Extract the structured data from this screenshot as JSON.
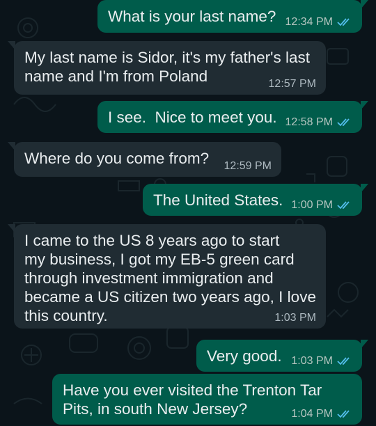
{
  "colors": {
    "background": "#0b141a",
    "outgoing_bubble": "#005c4b",
    "incoming_bubble": "#202c33",
    "read_ticks": "#53bdeb"
  },
  "messages": [
    {
      "direction": "out",
      "text": "What is your last name?",
      "time": "12:34 PM",
      "status": "read"
    },
    {
      "direction": "in",
      "text": "My last name is Sidor, it's my father's last\nname and I'm from Poland",
      "time": "12:57 PM"
    },
    {
      "direction": "out",
      "text": "I see.  Nice to meet you.",
      "time": "12:58 PM",
      "status": "read"
    },
    {
      "direction": "in",
      "text": "Where do you come from?",
      "time": "12:59 PM"
    },
    {
      "direction": "out",
      "text": "The United States.",
      "time": "1:00 PM",
      "status": "read"
    },
    {
      "direction": "in",
      "text": "I came to the US 8 years ago to start\nmy business, I got my EB-5 green card\nthrough investment immigration and\nbecame a US citizen two years ago, I love\nthis country.",
      "time": "1:03 PM"
    },
    {
      "direction": "out",
      "text": "Very good.",
      "time": "1:03 PM",
      "status": "read"
    },
    {
      "direction": "out",
      "text": "Have you ever visited the Trenton Tar\nPits, in south New Jersey?",
      "time": "1:04 PM",
      "status": "read"
    }
  ]
}
